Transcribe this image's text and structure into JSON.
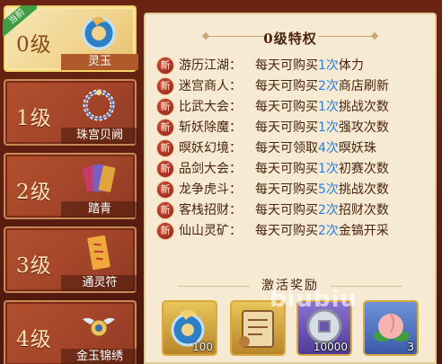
{
  "levels": [
    {
      "name": "0级",
      "reward": "灵玉",
      "active": true,
      "badge": "当前"
    },
    {
      "name": "1级",
      "reward": "珠宫贝阙"
    },
    {
      "name": "2级",
      "reward": "踏青"
    },
    {
      "name": "3级",
      "reward": "通灵符"
    },
    {
      "name": "4级",
      "reward": "金玉锦绣"
    }
  ],
  "panel": {
    "title": "0级特权",
    "new_badge": "新",
    "privileges": [
      {
        "name": "游历江湖：",
        "pre": "每天可购买",
        "num": "1次",
        "post": "体力"
      },
      {
        "name": "迷宫商人：",
        "pre": "每天可购买",
        "num": "2次",
        "post": "商店刷新"
      },
      {
        "name": "比武大会：",
        "pre": "每天可购买",
        "num": "1次",
        "post": "挑战次数"
      },
      {
        "name": "斩妖除魔：",
        "pre": "每天可购买",
        "num": "1次",
        "post": "强攻次数"
      },
      {
        "name": "暝妖幻境：",
        "pre": "每天可领取",
        "num": "4次",
        "post": "暝妖珠"
      },
      {
        "name": "品剑大会：",
        "pre": "每天可购买",
        "num": "1次",
        "post": "初赛次数"
      },
      {
        "name": "龙争虎斗：",
        "pre": "每天可购买",
        "num": "5次",
        "post": "挑战次数"
      },
      {
        "name": "客栈招财：",
        "pre": "每天可购买",
        "num": "2次",
        "post": "招财次数"
      },
      {
        "name": "仙山灵矿：",
        "pre": "每天可购买",
        "num": "2次",
        "post": "金镐开采"
      }
    ],
    "rewards_header": "激活奖励",
    "rewards": [
      {
        "icon": "jade-icon",
        "count": "100",
        "bg": "#3a6ea8"
      },
      {
        "icon": "scroll-icon",
        "count": "",
        "bg": "#b9894a"
      },
      {
        "icon": "coin-icon",
        "count": "10000",
        "bg": "#6a55a8"
      },
      {
        "icon": "peach-icon",
        "count": "3",
        "bg": "#4a6fb5"
      }
    ]
  },
  "watermark": "biubiu",
  "colors": {
    "highlight": "#2b7de0",
    "panel_bg": "#f6ead3",
    "card_bg": "#a4452a"
  }
}
